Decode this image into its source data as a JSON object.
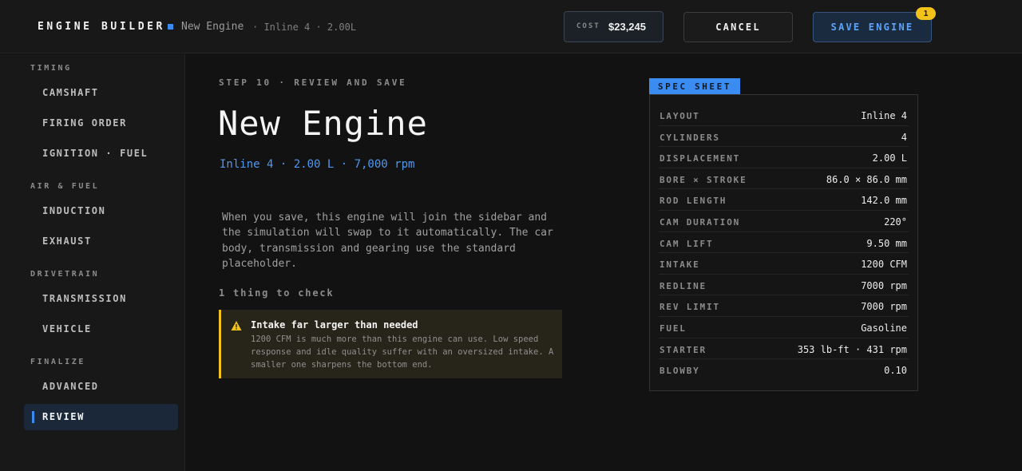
{
  "header": {
    "app_title": "ENGINE BUILDER",
    "engine_name": "New Engine",
    "engine_meta": "· Inline 4 · 2.00L",
    "cost_label": "COST",
    "cost_value": "$23,245",
    "cancel_label": "CANCEL",
    "save_label": "SAVE ENGINE",
    "save_badge": "1"
  },
  "sidebar": {
    "sections": [
      {
        "label": "TIMING",
        "items": [
          "CAMSHAFT",
          "FIRING ORDER",
          "IGNITION · FUEL"
        ]
      },
      {
        "label": "AIR & FUEL",
        "items": [
          "INDUCTION",
          "EXHAUST"
        ]
      },
      {
        "label": "DRIVETRAIN",
        "items": [
          "TRANSMISSION",
          "VEHICLE"
        ]
      },
      {
        "label": "FINALIZE",
        "items": [
          "ADVANCED",
          "REVIEW"
        ]
      }
    ],
    "active_item": "REVIEW"
  },
  "main": {
    "step": "STEP 10 · REVIEW AND SAVE",
    "title": "New Engine",
    "subtitle": "Inline 4 · 2.00 L · 7,000 rpm",
    "description": "When you save, this engine will join the sidebar and the simulation will swap to it automatically. The car body, transmission and gearing use the standard placeholder.",
    "check_count": "1 thing to check",
    "warning": {
      "title": "Intake far larger than needed",
      "body": "1200 CFM is much more than this engine can use. Low speed response and idle quality suffer with an oversized intake. A smaller one sharpens the bottom end.",
      "icon": "warning-triangle-icon",
      "color": "#f3c21a"
    }
  },
  "spec_sheet": {
    "tab_label": "SPEC SHEET",
    "rows": [
      {
        "key": "LAYOUT",
        "value": "Inline 4"
      },
      {
        "key": "CYLINDERS",
        "value": "4"
      },
      {
        "key": "DISPLACEMENT",
        "value": "2.00 L"
      },
      {
        "key": "BORE × STROKE",
        "value": "86.0 × 86.0 mm"
      },
      {
        "key": "ROD LENGTH",
        "value": "142.0 mm"
      },
      {
        "key": "CAM DURATION",
        "value": "220°"
      },
      {
        "key": "CAM LIFT",
        "value": "9.50 mm"
      },
      {
        "key": "INTAKE",
        "value": "1200 CFM"
      },
      {
        "key": "REDLINE",
        "value": "7000 rpm"
      },
      {
        "key": "REV LIMIT",
        "value": "7000 rpm"
      },
      {
        "key": "FUEL",
        "value": "Gasoline"
      },
      {
        "key": "STARTER",
        "value": "353 lb-ft · 431 rpm"
      },
      {
        "key": "BLOWBY",
        "value": "0.10"
      }
    ]
  },
  "colors": {
    "accent": "#3b8cf0",
    "warning": "#f3c21a",
    "background": "#121212"
  }
}
